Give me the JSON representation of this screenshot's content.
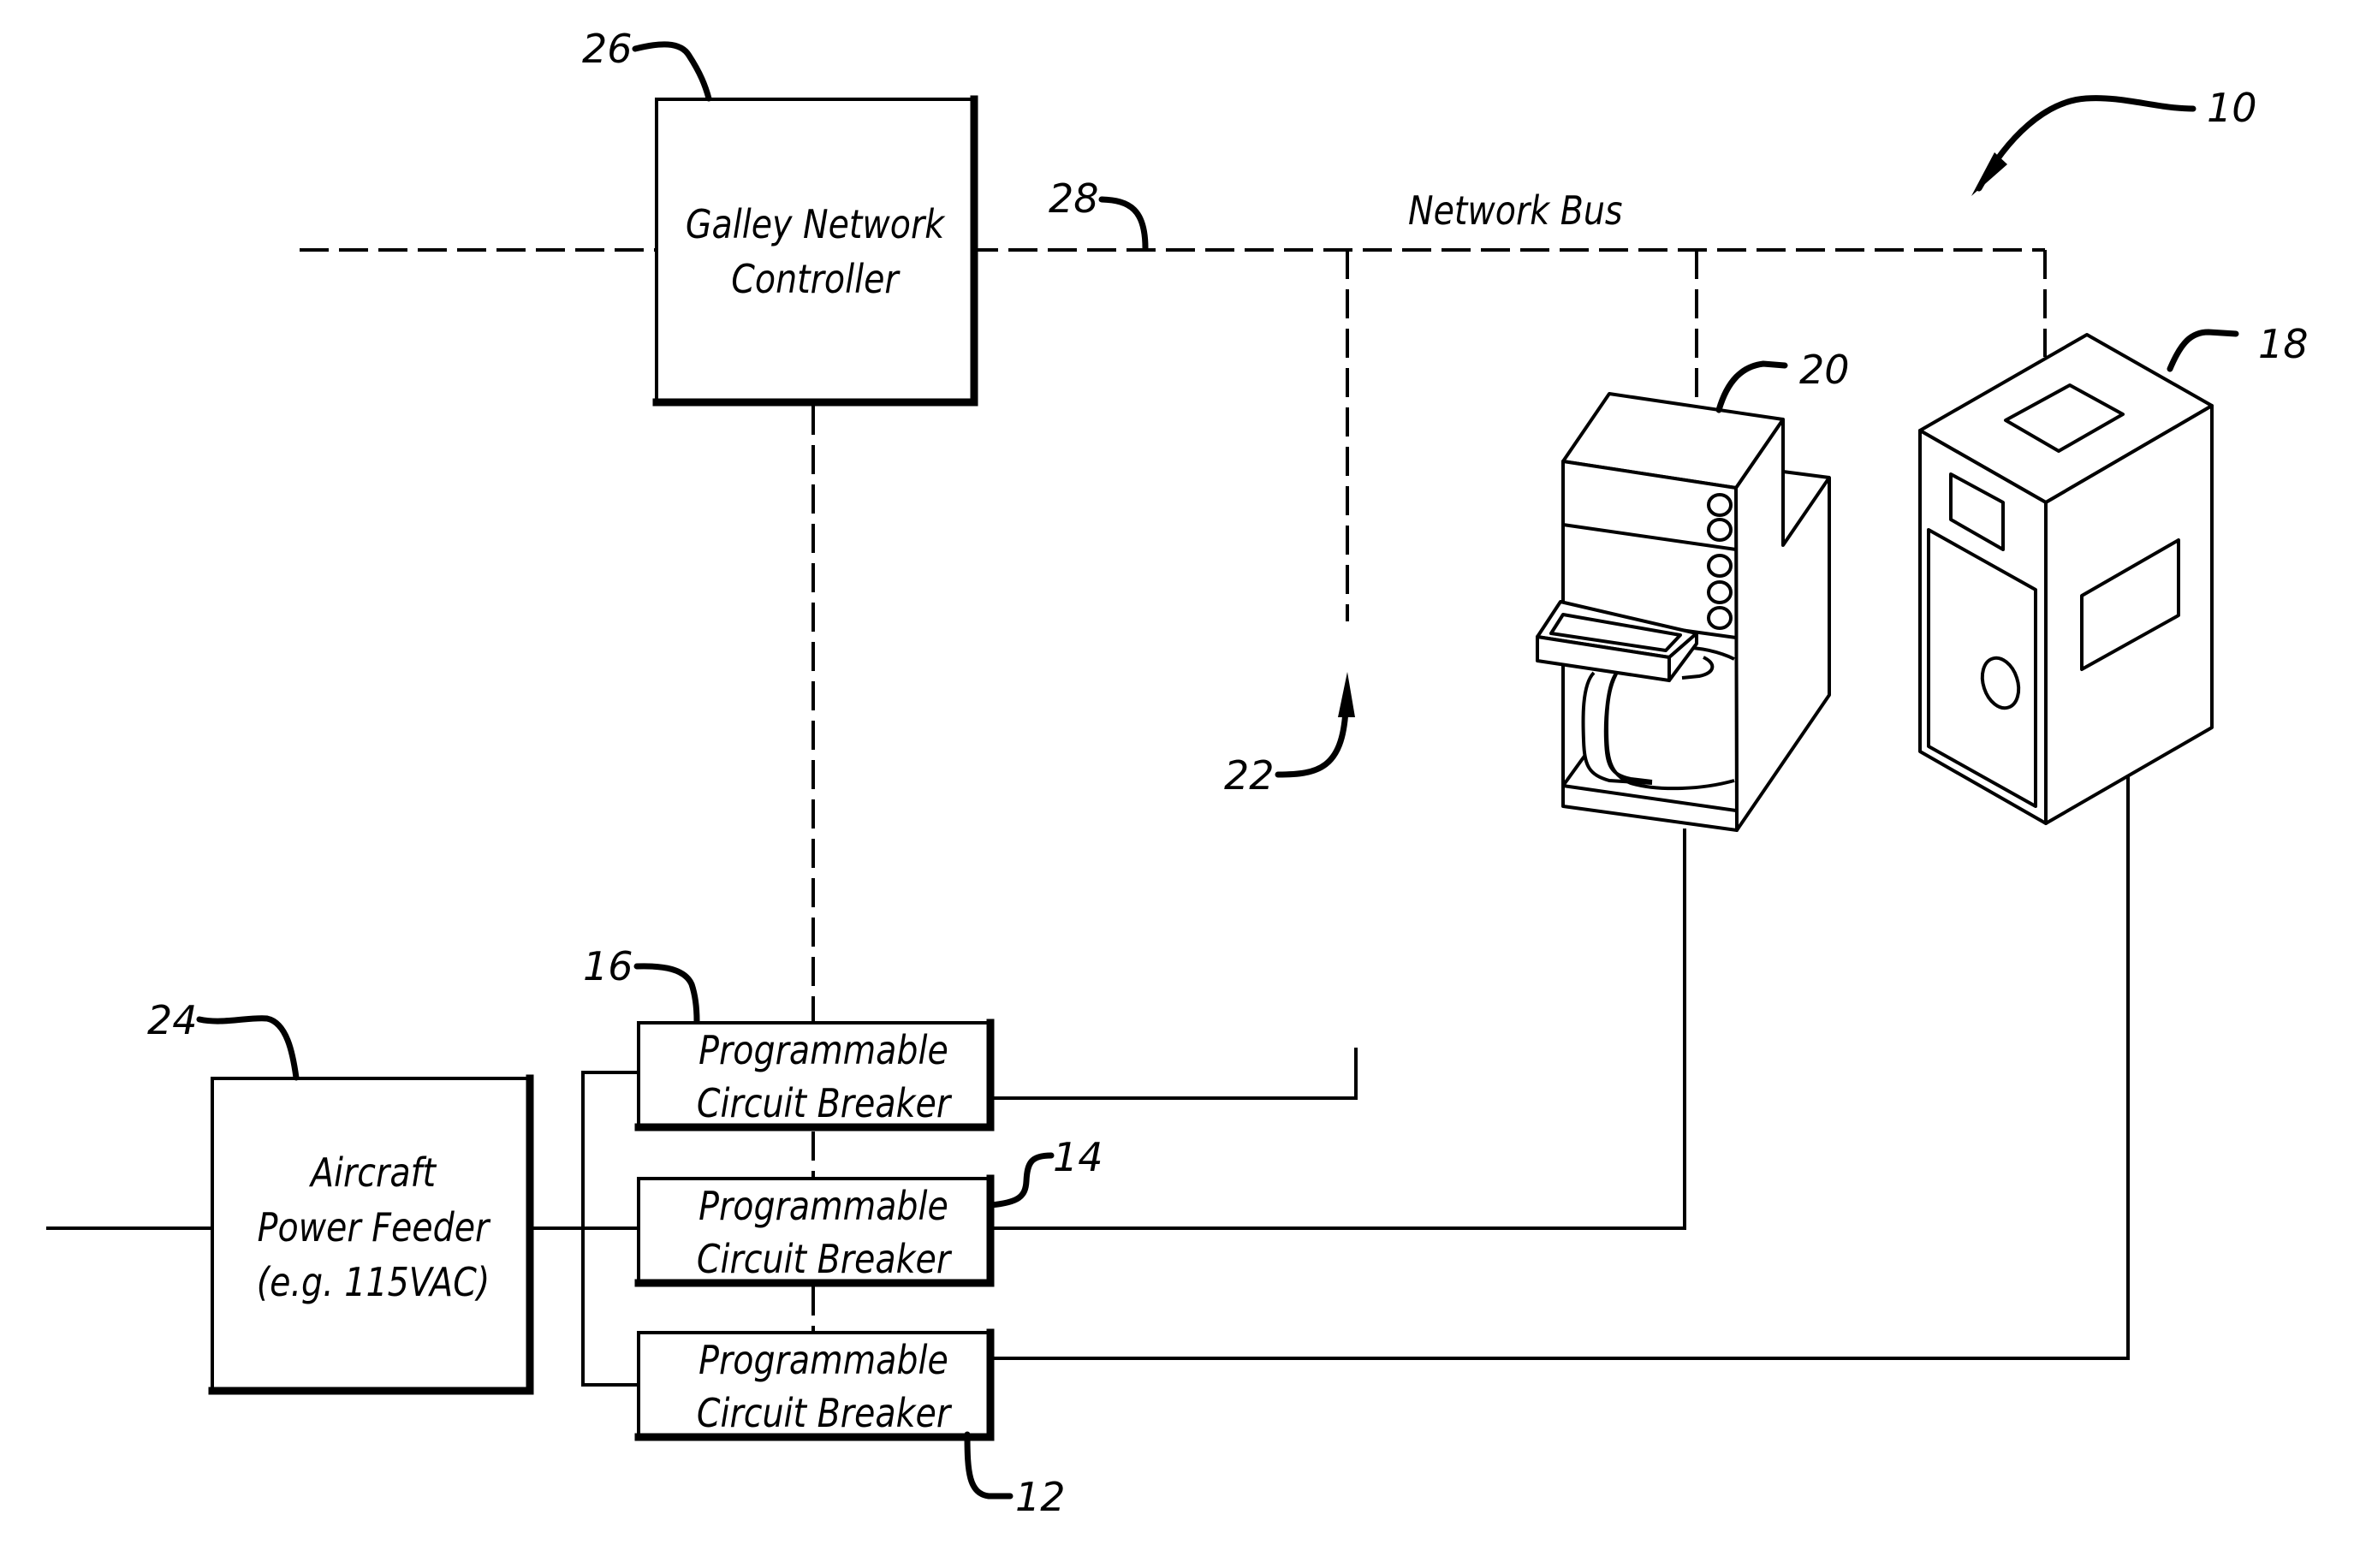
{
  "figure": {
    "reference_numeral": "10",
    "network_bus": {
      "label": "Network Bus",
      "ref": "28"
    },
    "galley_network_controller": {
      "lines": [
        "Galley Network",
        "Controller"
      ],
      "ref": "26"
    },
    "aircraft_power_feeder": {
      "lines": [
        "Aircraft",
        "Power Feeder",
        "(e.g. 115VAC)"
      ],
      "ref": "24"
    },
    "circuit_breakers": [
      {
        "lines": [
          "Programmable",
          "Circuit Breaker"
        ],
        "ref": "16"
      },
      {
        "lines": [
          "Programmable",
          "Circuit Breaker"
        ],
        "ref": "14"
      },
      {
        "lines": [
          "Programmable",
          "Circuit Breaker"
        ],
        "ref": "12"
      }
    ],
    "unconnected_port": {
      "ref": "22"
    },
    "coffee_maker": {
      "ref": "20"
    },
    "oven": {
      "ref": "18"
    }
  }
}
